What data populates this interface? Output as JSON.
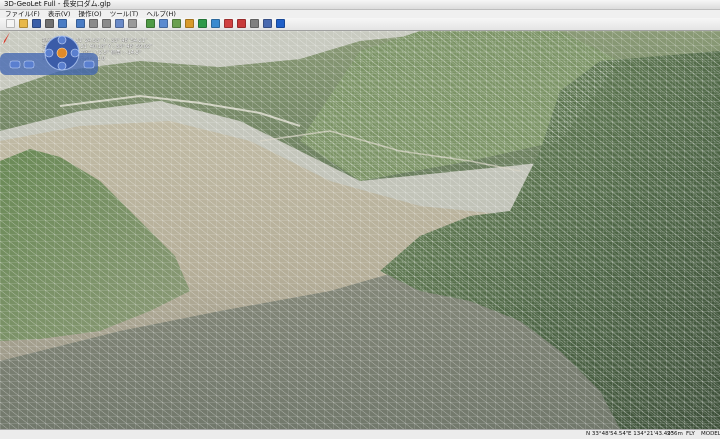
{
  "window": {
    "title": "3D-GeoLet Full - 長安口ダム.glp"
  },
  "menu": {
    "items": [
      "ファイル(F)",
      "表示(V)",
      "操作(O)",
      "ツール(T)",
      "ヘルプ(H)"
    ]
  },
  "toolbar": {
    "buttons": [
      {
        "name": "new-file-icon",
        "color": "#f5f5f5"
      },
      {
        "name": "open-folder-icon",
        "color": "#e8b84a"
      },
      {
        "name": "save-icon",
        "color": "#3b5fa8"
      },
      {
        "name": "print-icon",
        "color": "#707070"
      },
      {
        "name": "import-icon",
        "color": "#4a7cc4"
      },
      {
        "name": "export-icon",
        "color": "#4a7cc4"
      },
      {
        "name": "layer-icon",
        "color": "#8a8a8a"
      },
      {
        "name": "list-icon",
        "color": "#8a8a8a"
      },
      {
        "name": "grid-icon",
        "color": "#6a8ac8"
      },
      {
        "name": "sphere-icon",
        "color": "#9a9a9a"
      },
      {
        "name": "terrain-icon",
        "color": "#4f9a45"
      },
      {
        "name": "texture-icon",
        "color": "#5a8ad0"
      },
      {
        "name": "shade-icon",
        "color": "#6aa04f"
      },
      {
        "name": "light-icon",
        "color": "#d89a2a"
      },
      {
        "name": "measure-icon",
        "color": "#2f9a4a"
      },
      {
        "name": "graph-icon",
        "color": "#3a8acf"
      },
      {
        "name": "section-icon",
        "color": "#d04040"
      },
      {
        "name": "marker-icon",
        "color": "#c83a3a"
      },
      {
        "name": "tool-icon",
        "color": "#808080"
      },
      {
        "name": "settings-icon",
        "color": "#4a6ab0"
      },
      {
        "name": "help-icon",
        "color": "#1f5fc8"
      }
    ]
  },
  "hud": {
    "lines": [
      "視点  X  : 134° 21' 24.53\"   Y : 33° 48' 54.21\"",
      "注視点 X : 134° 21' 40.18\"   Y : 33° 48' 59.02\"",
      "高さ : 238.00m   方位 : 72.5°   俯角 : -14.3°",
      "画角 : 45.0°   表示倍率 : 1.0"
    ]
  },
  "status": {
    "latitude": "N  33°48'54.54\"",
    "longitude": "E  134°21'43.49\"",
    "altitude": "236m",
    "mode": "FLY",
    "model": "MODEL"
  },
  "colors": {
    "mesh": "#ffffff",
    "sky": "#c7c9bf",
    "valley_floor": "#b8b09a",
    "vegetation": "#5f7a4f",
    "nav_pad": "#3e63b2",
    "accent_orange": "#e08a2a"
  }
}
